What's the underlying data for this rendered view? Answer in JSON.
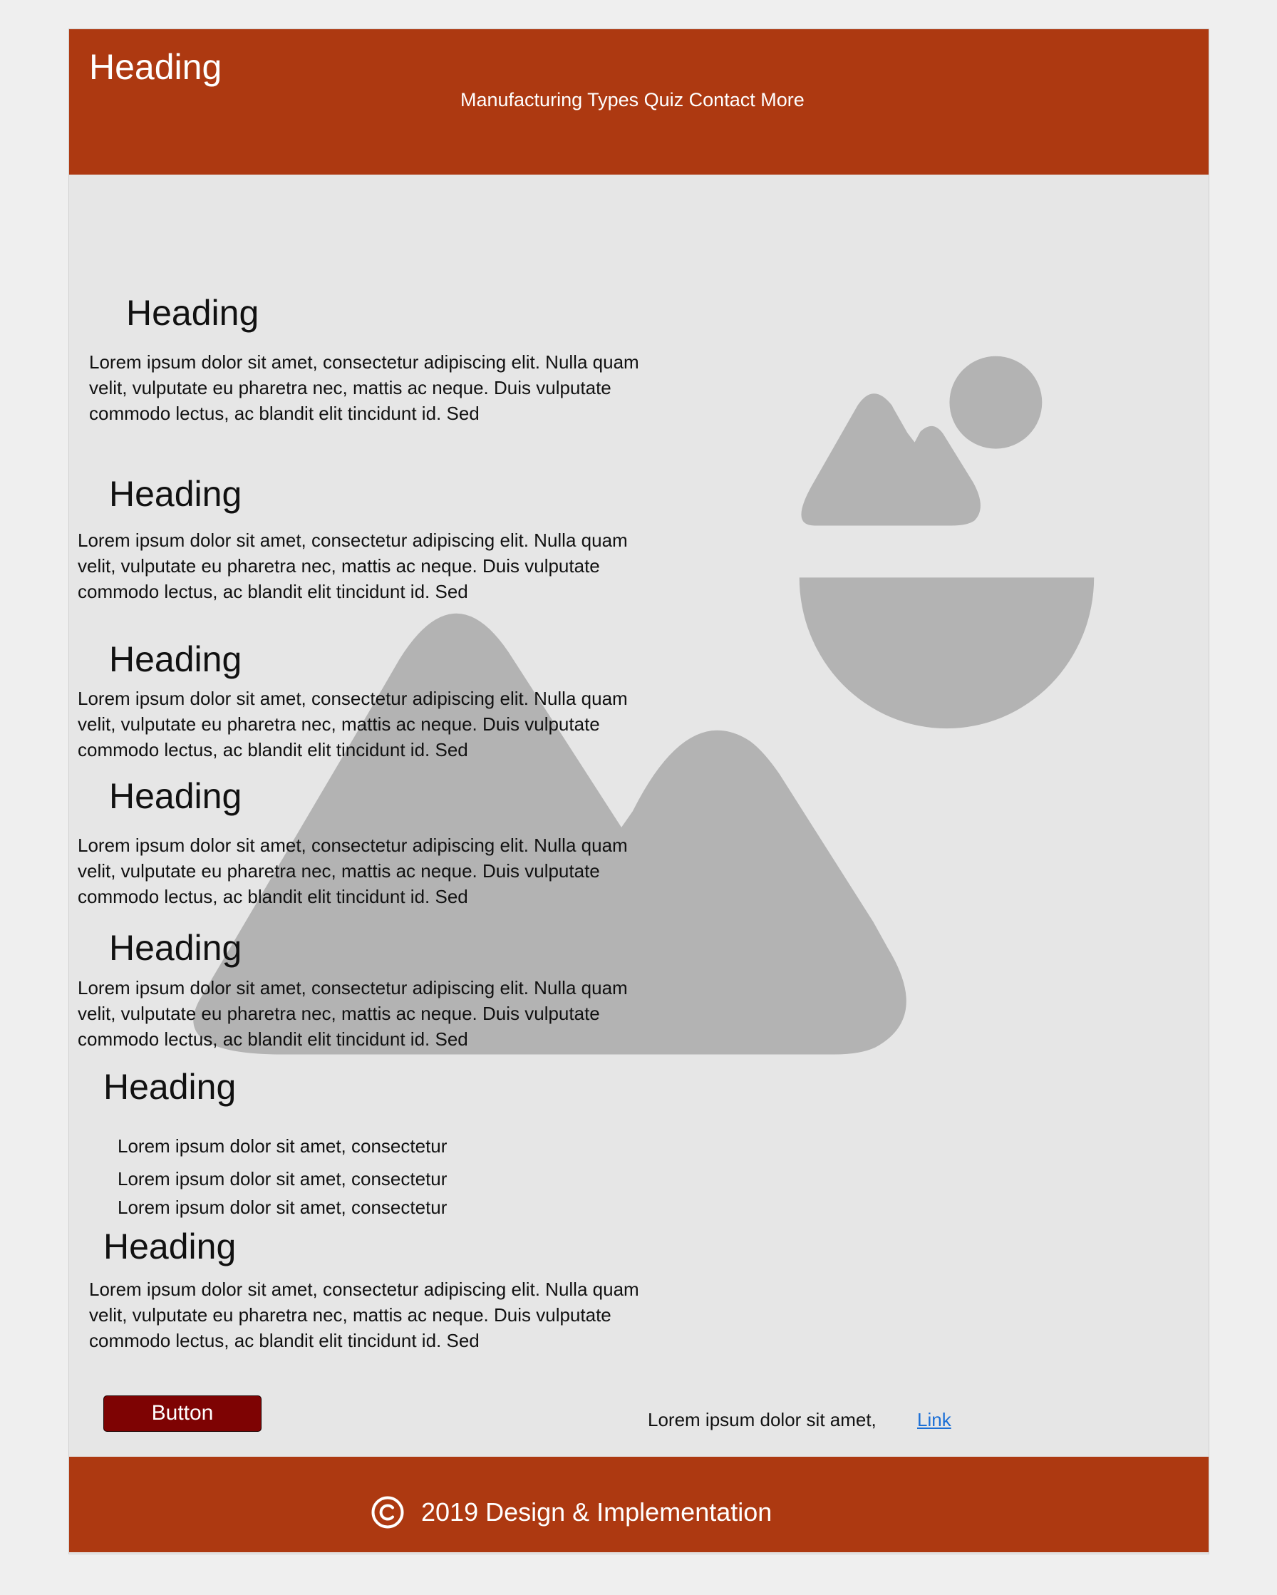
{
  "colors": {
    "brand": "#ad3911",
    "page_bg": "#efefef",
    "content_bg": "#e6e6e6",
    "placeholder": "#b3b3b3",
    "button_bg": "#7e0303",
    "link": "#1b6fd6"
  },
  "header": {
    "title": "Heading",
    "nav_text": "Manufacturing Types Quiz Contact More"
  },
  "sections": [
    {
      "heading": "Heading",
      "text": "Lorem ipsum dolor sit amet, consectetur adipiscing elit. Nulla quam velit, vulputate eu pharetra nec, mattis ac neque. Duis vulputate commodo lectus, ac blandit elit tincidunt id. Sed"
    },
    {
      "heading": "Heading",
      "text": "Lorem ipsum dolor sit amet, consectetur adipiscing elit. Nulla quam velit, vulputate eu pharetra nec, mattis ac neque. Duis vulputate commodo lectus, ac blandit elit tincidunt id. Sed"
    },
    {
      "heading": "Heading",
      "text": "Lorem ipsum dolor sit amet, consectetur adipiscing elit. Nulla quam velit, vulputate eu pharetra nec, mattis ac neque. Duis vulputate commodo lectus, ac blandit elit tincidunt id. Sed"
    },
    {
      "heading": "Heading",
      "text": "Lorem ipsum dolor sit amet, consectetur adipiscing elit. Nulla quam velit, vulputate eu pharetra nec, mattis ac neque. Duis vulputate commodo lectus, ac blandit elit tincidunt id. Sed"
    },
    {
      "heading": "Heading",
      "text": "Lorem ipsum dolor sit amet, consectetur adipiscing elit. Nulla quam velit, vulputate eu pharetra nec, mattis ac neque. Duis vulputate commodo lectus, ac blandit elit tincidunt id. Sed"
    }
  ],
  "list_section": {
    "heading": "Heading",
    "items": [
      "Lorem ipsum dolor sit amet, consectetur",
      "Lorem ipsum dolor sit amet, consectetur",
      "Lorem ipsum dolor sit amet, consectetur"
    ]
  },
  "last_section": {
    "heading": "Heading",
    "text": "Lorem ipsum dolor sit amet, consectetur adipiscing elit. Nulla quam velit, vulputate eu pharetra nec, mattis ac neque. Duis vulputate commodo lectus, ac blandit elit tincidunt id. Sed"
  },
  "actions": {
    "button_label": "Button",
    "footer_text": "Lorem ipsum dolor sit amet,",
    "link_label": "Link"
  },
  "footer": {
    "copyright_icon": "copyright-icon",
    "copyright_text": "2019 Design & Implementation"
  },
  "image_placeholder_icon": "image-placeholder-icon"
}
